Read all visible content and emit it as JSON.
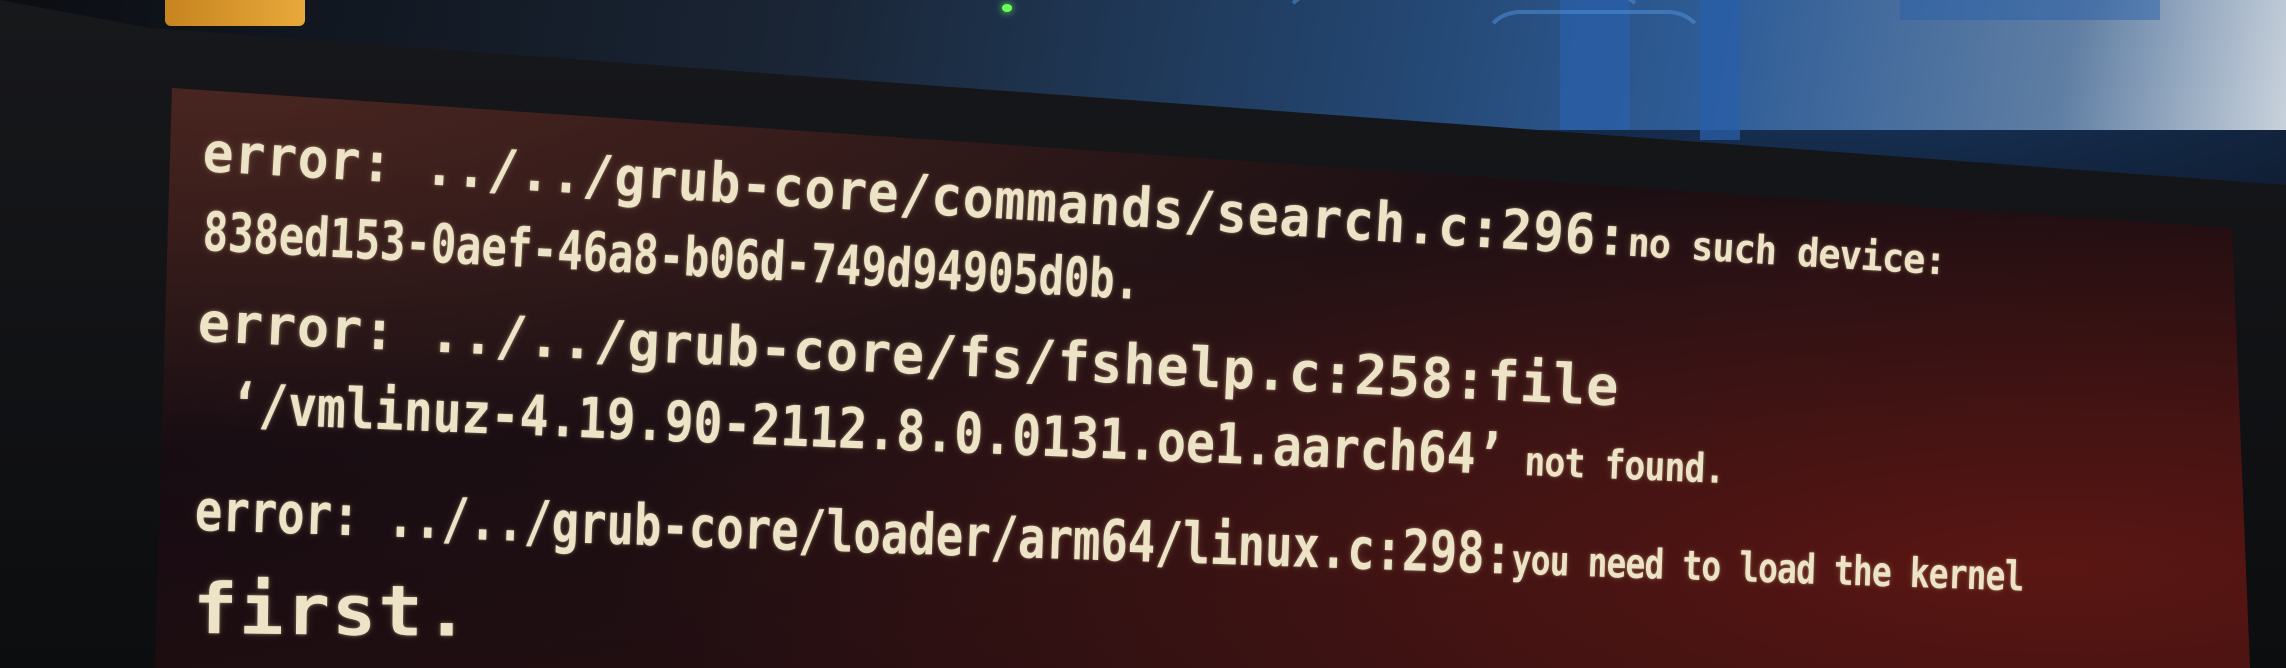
{
  "photo": {
    "subject": "monitor-showing-grub-boot-errors",
    "colors": {
      "screen_bg": "#1a0d10",
      "text": "#ede3c6",
      "bezel": "#111215",
      "rack_blue": "#2a5fa8"
    }
  },
  "terminal": {
    "lines": [
      {
        "main": "error: ../../grub-core/commands/search.c:296:",
        "tail": "no such device:"
      },
      {
        "main": "838ed153-0aef-46a8-b06d-749d94905d0b.",
        "tail": ""
      },
      {
        "main": "error: ../../grub-core/fs/fshelp.c:258:file",
        "tail": ""
      },
      {
        "main": "‘/vmlinuz-4.19.90-2112.8.0.0131.oe1.aarch64’",
        "tail": " not found."
      },
      {
        "main": "error: ../../grub-core/loader/arm64/linux.c:298:",
        "tail": "you need to load the kernel"
      },
      {
        "main": "first.",
        "tail": ""
      }
    ]
  }
}
